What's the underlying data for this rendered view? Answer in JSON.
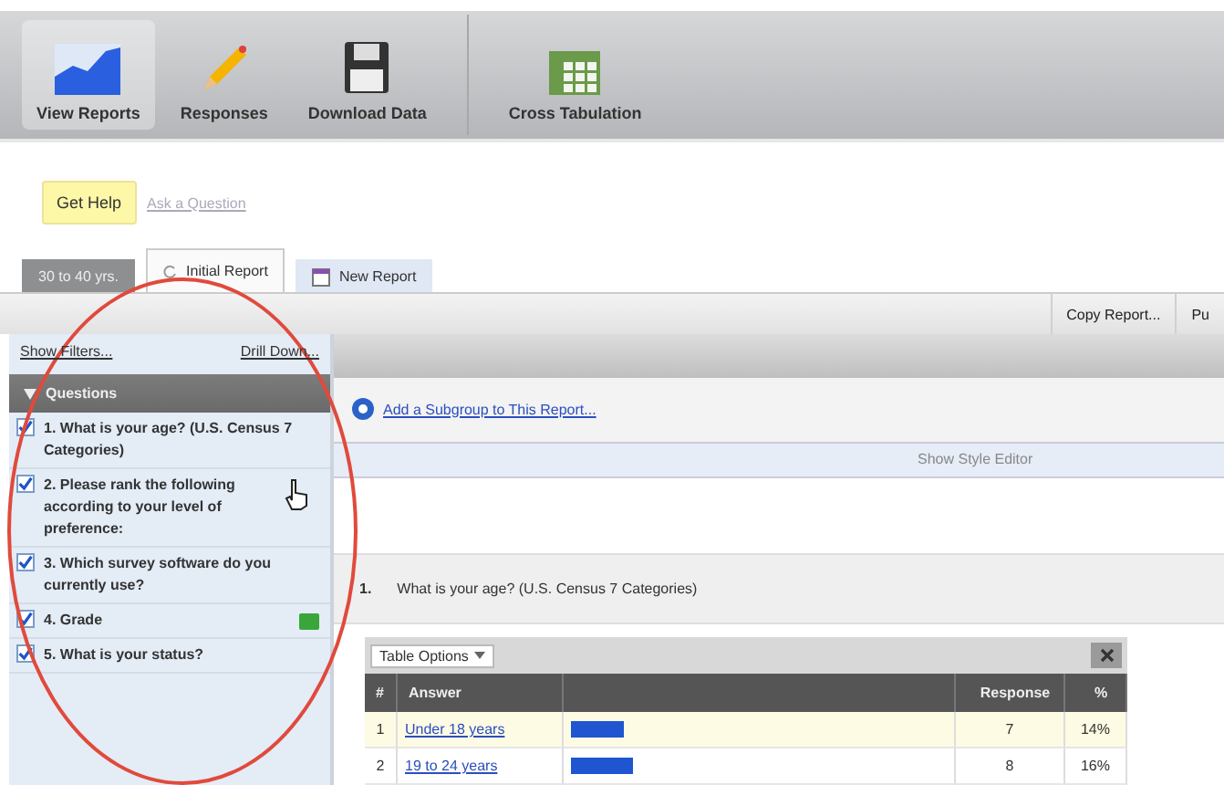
{
  "toolbar": [
    {
      "label": "View Reports",
      "selected": true
    },
    {
      "label": "Responses",
      "selected": false
    },
    {
      "label": "Download Data",
      "selected": false
    },
    {
      "label": "Cross Tabulation",
      "selected": false
    }
  ],
  "help": {
    "button": "Get Help",
    "link": "Ask a Question"
  },
  "tabs": [
    {
      "label": "30 to 40 yrs.",
      "kind": "filter",
      "selected": false
    },
    {
      "label": "Initial Report",
      "kind": "report",
      "selected": true
    },
    {
      "label": "New Report",
      "kind": "new",
      "selected": false
    }
  ],
  "actions": [
    "Copy Report...",
    "Pu"
  ],
  "sidebar": {
    "links": [
      "Show Filters...",
      "Drill Down..."
    ],
    "header": "Questions",
    "expanded": true,
    "items": [
      {
        "label": "1. What is your age? (U.S. Census 7 Categories)",
        "checked": true,
        "badge": false
      },
      {
        "label": "2. Please rank the following according to your level of preference:",
        "checked": true,
        "badge": false
      },
      {
        "label": "3. Which survey software do you currently use?",
        "checked": true,
        "badge": false
      },
      {
        "label": "4. Grade",
        "checked": true,
        "badge": true
      },
      {
        "label": "5. What is your status?",
        "checked": true,
        "badge": false
      }
    ]
  },
  "subgroup_link": "Add a Subgroup to This Report...",
  "style_editor": "Show Style Editor",
  "question": {
    "number": "1.",
    "text": "What is your age? (U.S. Census 7 Categories)"
  },
  "table": {
    "options": "Table Options",
    "columns": [
      "#",
      "Answer",
      "Response",
      "%"
    ],
    "rows": [
      {
        "index": "1",
        "answer": "Under 18 years",
        "level": 0.14,
        "response": "7",
        "percent": "14%"
      },
      {
        "index": "2",
        "answer": "19 to 24 years",
        "level": 0.16,
        "response": "8",
        "percent": "16%"
      }
    ]
  }
}
